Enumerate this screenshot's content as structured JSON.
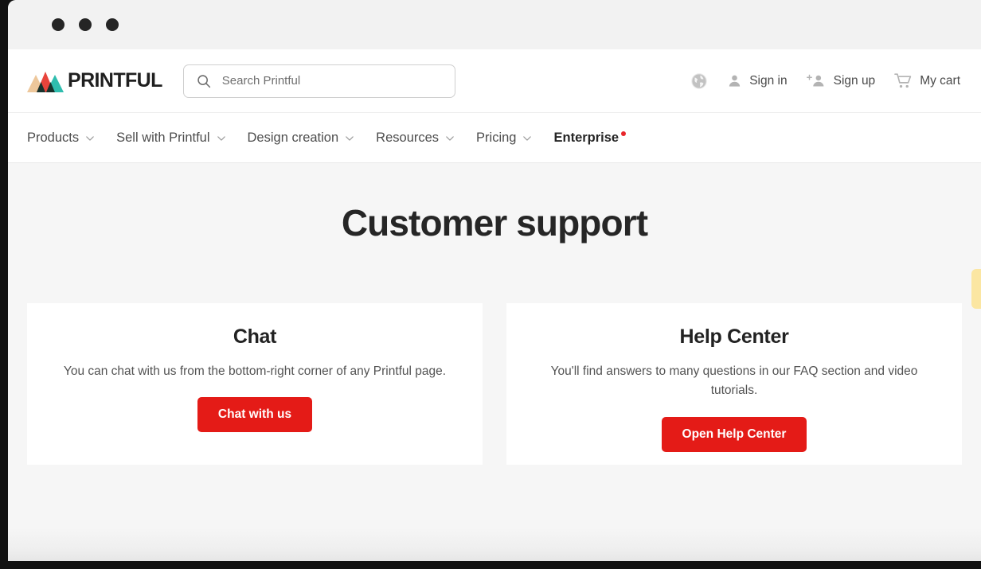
{
  "window": {
    "traffic_lights": [
      "close-dot",
      "minimize-dot",
      "maximize-dot"
    ]
  },
  "header": {
    "logo_word": "PRINTFUL",
    "logo_icon": "printful-mountains-logo",
    "logo_colors": {
      "tan": "#EDC79B",
      "red": "#E8443C",
      "teal": "#2FBDAE",
      "dark": "#17322C"
    },
    "search": {
      "icon": "search-icon",
      "placeholder": "Search Printful",
      "value": ""
    },
    "actions": [
      {
        "icon": "globe-icon",
        "label": ""
      },
      {
        "icon": "person-icon",
        "label": "Sign in"
      },
      {
        "icon": "person-plus-icon",
        "label": "Sign up"
      },
      {
        "icon": "shopping-cart-icon",
        "label": "My cart"
      }
    ]
  },
  "nav": {
    "items": [
      {
        "label": "Products",
        "has_chevron": true,
        "bold": false,
        "has_dot": false
      },
      {
        "label": "Sell with Printful",
        "has_chevron": true,
        "bold": false,
        "has_dot": false
      },
      {
        "label": "Design creation",
        "has_chevron": true,
        "bold": false,
        "has_dot": false
      },
      {
        "label": "Resources",
        "has_chevron": true,
        "bold": false,
        "has_dot": false
      },
      {
        "label": "Pricing",
        "has_chevron": true,
        "bold": false,
        "has_dot": false
      },
      {
        "label": "Enterprise",
        "has_chevron": false,
        "bold": true,
        "has_dot": true
      }
    ]
  },
  "main": {
    "title": "Customer support",
    "cards": [
      {
        "title": "Chat",
        "description": "You can chat with us from the bottom-right corner of any Printful page.",
        "button_label": "Chat with us"
      },
      {
        "title": "Help Center",
        "description": "You'll find answers to many questions in our FAQ section and video tutorials.",
        "button_label": "Open Help Center"
      }
    ],
    "feedback_tab": {
      "name": "feedback-tab",
      "color": "#FBE6A2"
    }
  },
  "colors": {
    "brand_red": "#E41B17",
    "page_background": "#F6F6F6",
    "card_background": "#FFFFFF",
    "text_dark": "#262626",
    "text_muted": "#535353"
  }
}
